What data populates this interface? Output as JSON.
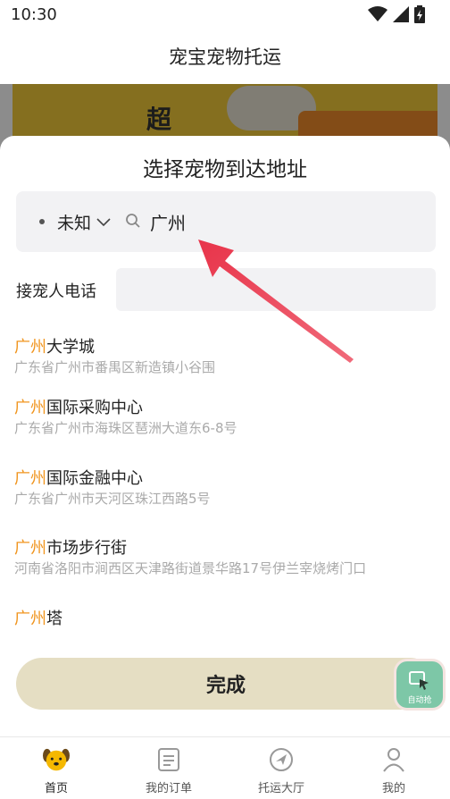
{
  "status_bar": {
    "time": "10:30",
    "icons": [
      "wifi-icon",
      "signal-icon",
      "battery-icon"
    ]
  },
  "header": {
    "title": "宠宝宠物托运"
  },
  "banner": {
    "char": "超"
  },
  "sheet": {
    "title": "选择宠物到达地址",
    "gender_select": "未知",
    "search_value": "广州",
    "phone_label": "接宠人电话",
    "phone_value": "",
    "results": [
      {
        "highlight": "广州",
        "name_rest": "大学城",
        "address": "广东省广州市番禺区新造镇小谷围"
      },
      {
        "highlight": "广州",
        "name_rest": "国际采购中心",
        "address": "广东省广州市海珠区琶洲大道东6-8号"
      },
      {
        "highlight": "广州",
        "name_rest": "国际金融中心",
        "address": "广东省广州市天河区珠江西路5号"
      },
      {
        "highlight": "广州",
        "name_rest": "市场步行街",
        "address": "河南省洛阳市涧西区天津路街道景华路17号伊兰宰烧烤门口"
      },
      {
        "highlight": "广州",
        "name_rest": "塔",
        "address": ""
      }
    ],
    "done_label": "完成"
  },
  "floating_button": {
    "label": "自动抢"
  },
  "nav": [
    {
      "label": "首页",
      "icon": "dog-face-icon",
      "active": true
    },
    {
      "label": "我的订单",
      "icon": "order-list-icon",
      "active": false
    },
    {
      "label": "托运大厅",
      "icon": "plane-compass-icon",
      "active": false
    },
    {
      "label": "我的",
      "icon": "user-icon",
      "active": false
    }
  ],
  "colors": {
    "highlight": "#f0951f",
    "accent_button": "#e5dec3",
    "annotation_arrow": "#e8344a"
  }
}
